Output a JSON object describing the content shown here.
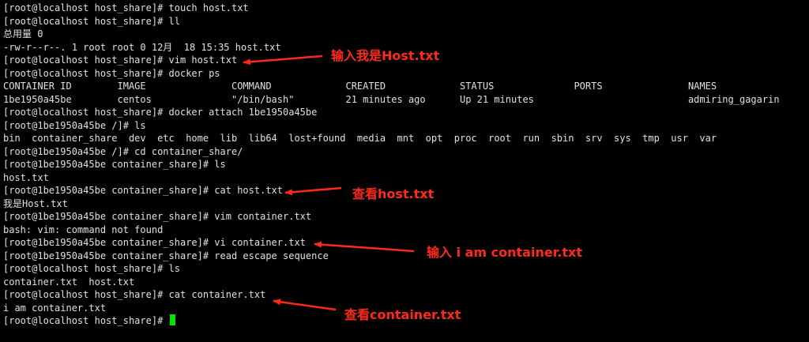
{
  "terminal": {
    "lines": [
      "[root@localhost host_share]# touch host.txt",
      "[root@localhost host_share]# ll",
      "总用量 0",
      "-rw-r--r--. 1 root root 0 12月  18 15:35 host.txt",
      "[root@localhost host_share]# vim host.txt",
      "[root@localhost host_share]# docker ps",
      "CONTAINER ID        IMAGE               COMMAND             CREATED             STATUS              PORTS               NAMES",
      "1be1950a45be        centos              \"/bin/bash\"         21 minutes ago      Up 21 minutes                           admiring_gagarin",
      "[root@localhost host_share]# docker attach 1be1950a45be",
      "[root@1be1950a45be /]# ls",
      "bin  container_share  dev  etc  home  lib  lib64  lost+found  media  mnt  opt  proc  root  run  sbin  srv  sys  tmp  usr  var",
      "[root@1be1950a45be /]# cd container_share/",
      "[root@1be1950a45be container_share]# ls",
      "host.txt",
      "[root@1be1950a45be container_share]# cat host.txt",
      "我是Host.txt",
      "[root@1be1950a45be container_share]# vim container.txt",
      "bash: vim: command not found",
      "[root@1be1950a45be container_share]# vi container.txt",
      "[root@1be1950a45be container_share]# read escape sequence",
      "[root@localhost host_share]# ls",
      "container.txt  host.txt",
      "[root@localhost host_share]# cat container.txt",
      "i am container.txt"
    ],
    "prompt": "[root@localhost host_share]# ",
    "cursor_color": "#00e400",
    "text_color": "#e0e0e0",
    "background": "#000000"
  },
  "annotations": {
    "color": "#ff2a1a",
    "items": [
      "输入我是Host.txt",
      "查看host.txt",
      "输入 i am container.txt",
      "查看container.txt"
    ]
  }
}
